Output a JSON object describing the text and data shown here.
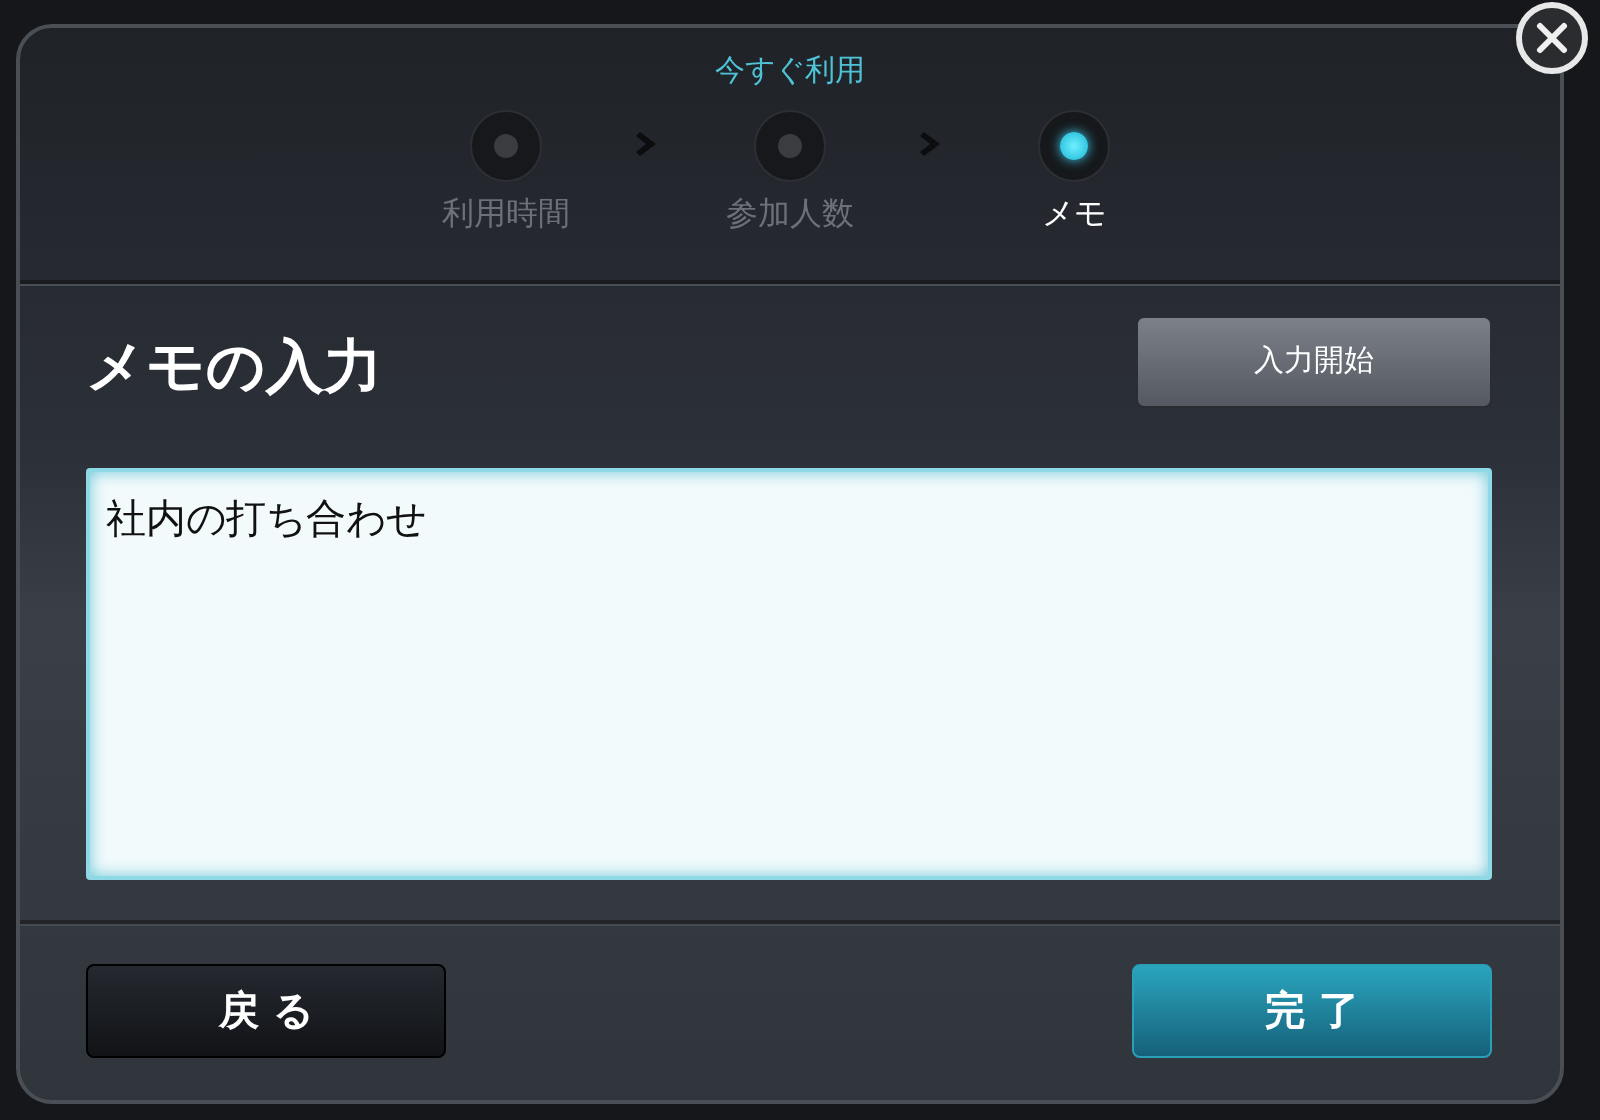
{
  "dialog": {
    "title": "今すぐ利用",
    "steps": [
      {
        "label": "利用時間",
        "selected": false
      },
      {
        "label": "参加人数",
        "selected": false
      },
      {
        "label": "メモ",
        "selected": true
      }
    ],
    "heading": "メモの入力",
    "start_button": "入力開始",
    "memo": {
      "value": "社内の打ち合わせ"
    },
    "buttons": [
      {
        "kind": "back",
        "label": "戻 る"
      },
      {
        "kind": "done",
        "label": "完 了"
      }
    ]
  }
}
